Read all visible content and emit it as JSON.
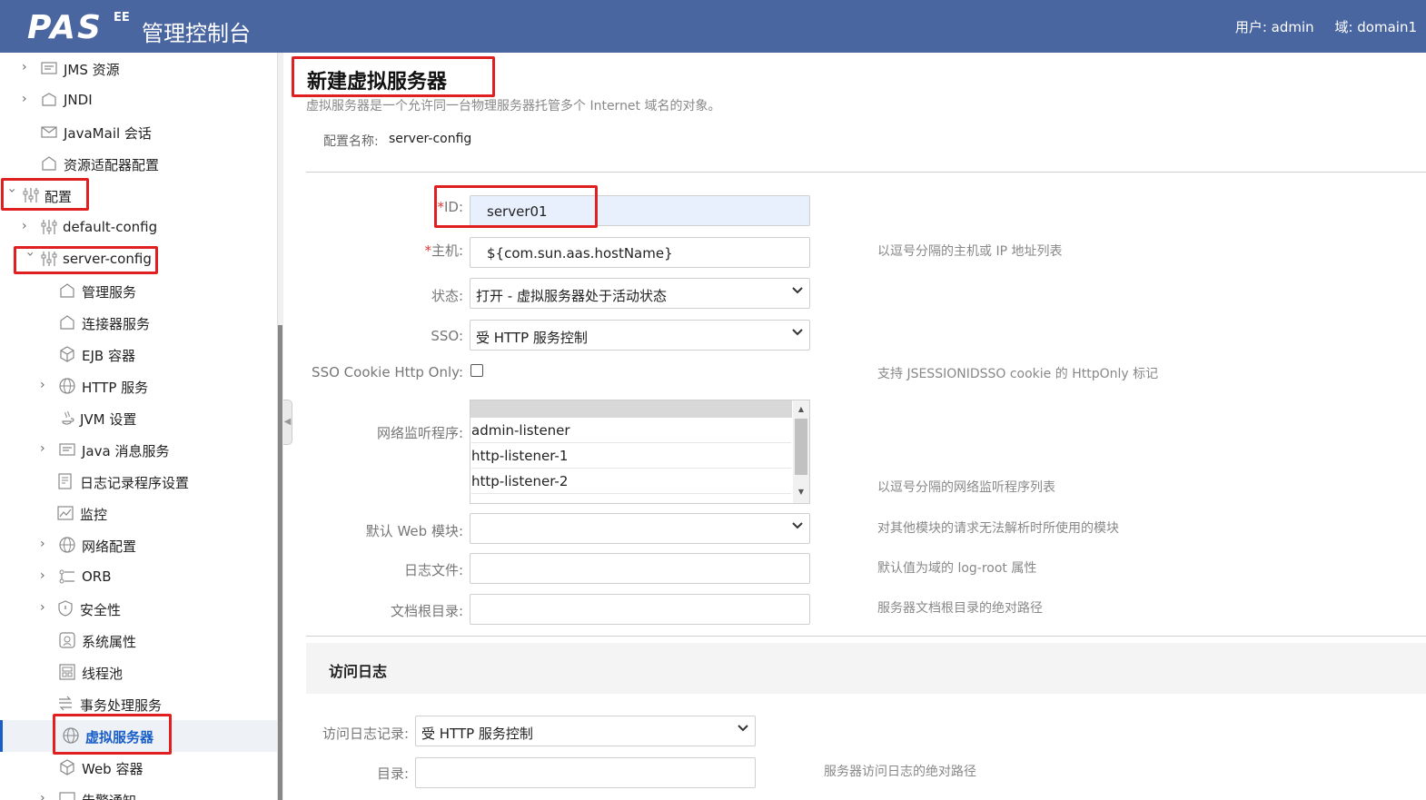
{
  "header": {
    "logo": "PAS",
    "logo_sup": "EE",
    "title": "管理控制台",
    "user": "用户: admin",
    "domain": "域: domain1"
  },
  "sidebar": {
    "items": [
      {
        "label": "JMS 资源",
        "icon": "jms-icon",
        "expandable": true
      },
      {
        "label": "JNDI",
        "icon": "jndi-icon",
        "expandable": true
      },
      {
        "label": "JavaMail 会话",
        "icon": "mail-icon",
        "expandable": false
      },
      {
        "label": "资源适配器配置",
        "icon": "adapter-icon",
        "expandable": false
      },
      {
        "label": "配置",
        "icon": "config-icon",
        "expandable": true,
        "expanded": true
      },
      {
        "label": "default-config",
        "icon": "config-icon",
        "expandable": true
      },
      {
        "label": "server-config",
        "icon": "config-icon",
        "expandable": true,
        "expanded": true
      },
      {
        "label": "管理服务",
        "icon": "service-icon",
        "expandable": false
      },
      {
        "label": "连接器服务",
        "icon": "service-icon",
        "expandable": false
      },
      {
        "label": "EJB 容器",
        "icon": "container-icon",
        "expandable": false
      },
      {
        "label": "HTTP 服务",
        "icon": "http-icon",
        "expandable": true
      },
      {
        "label": "JVM 设置",
        "icon": "java-icon",
        "expandable": false
      },
      {
        "label": "Java 消息服务",
        "icon": "jms-icon",
        "expandable": true
      },
      {
        "label": "日志记录程序设置",
        "icon": "log-icon",
        "expandable": false
      },
      {
        "label": "监控",
        "icon": "monitor-icon",
        "expandable": false
      },
      {
        "label": "网络配置",
        "icon": "http-icon",
        "expandable": true
      },
      {
        "label": "ORB",
        "icon": "orb-icon",
        "expandable": true
      },
      {
        "label": "安全性",
        "icon": "shield-icon",
        "expandable": true
      },
      {
        "label": "系统属性",
        "icon": "properties-icon",
        "expandable": false
      },
      {
        "label": "线程池",
        "icon": "threadpool-icon",
        "expandable": false
      },
      {
        "label": "事务处理服务",
        "icon": "transaction-icon",
        "expandable": false
      },
      {
        "label": "虚拟服务器",
        "icon": "http-icon",
        "expandable": false,
        "active": true
      },
      {
        "label": "Web 容器",
        "icon": "container-icon",
        "expandable": false
      },
      {
        "label": "告警通知",
        "icon": "alert-icon",
        "expandable": true
      }
    ]
  },
  "page": {
    "title": "新建虚拟服务器",
    "description": "虚拟服务器是一个允许同一台物理服务器托管多个 Internet 域名的对象。",
    "config_label": "配置名称:",
    "config_value": "server-config"
  },
  "form": {
    "id": {
      "required": "*",
      "label": "ID:",
      "value": "server01"
    },
    "host": {
      "required": "*",
      "label": "主机:",
      "value": "${com.sun.aas.hostName}",
      "hint": "以逗号分隔的主机或 IP 地址列表"
    },
    "state": {
      "label": "状态:",
      "value": "打开 - 虚拟服务器处于活动状态"
    },
    "sso": {
      "label": "SSO:",
      "value": "受 HTTP 服务控制"
    },
    "sso_cookie": {
      "label": "SSO Cookie Http Only:",
      "checked": false,
      "hint": "支持 JSESSIONIDSSO cookie 的 HttpOnly 标记"
    },
    "listeners": {
      "label": "网络监听程序:",
      "options": [
        "admin-listener",
        "http-listener-1",
        "http-listener-2"
      ],
      "hint": "以逗号分隔的网络监听程序列表"
    },
    "default_web_module": {
      "label": "默认 Web 模块:",
      "value": "",
      "hint": "对其他模块的请求无法解析时所使用的模块"
    },
    "log_file": {
      "label": "日志文件:",
      "value": "",
      "hint": "默认值为域的 log-root 属性"
    },
    "docroot": {
      "label": "文档根目录:",
      "value": "",
      "hint": "服务器文档根目录的绝对路径"
    }
  },
  "access_log": {
    "title": "访问日志",
    "logging": {
      "label": "访问日志记录:",
      "value": "受 HTTP 服务控制"
    },
    "directory": {
      "label": "目录:",
      "value": "",
      "hint": "服务器访问日志的绝对路径"
    }
  },
  "colors": {
    "header_bg": "#4a66a0",
    "highlight": "#e02020",
    "active_link": "#1a5fc8"
  }
}
